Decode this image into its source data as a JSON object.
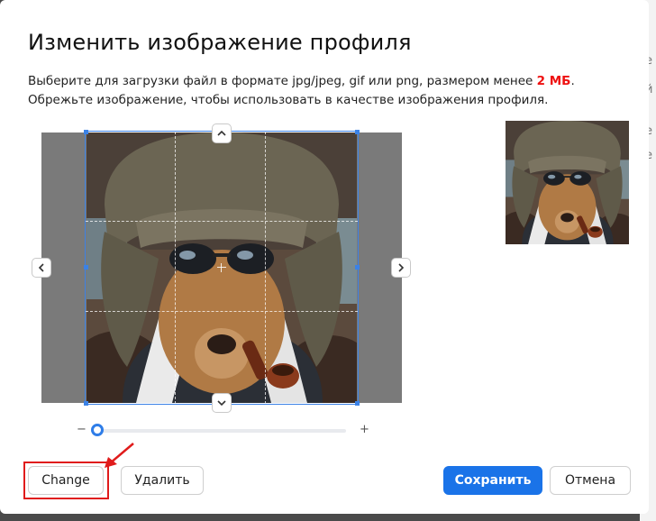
{
  "backdrop": {
    "glyphs": [
      "е",
      "й",
      "е",
      "е"
    ]
  },
  "dialog": {
    "title": "Изменить изображение профиля",
    "description_prefix": "Выберите для загрузки файл в формате jpg/jpeg, gif или png, размером менее ",
    "size_limit": "2 МБ",
    "description_suffix": ".",
    "description_line2": "Обрежьте изображение, чтобы использовать в качестве изображения профиля."
  },
  "cropper": {
    "image": "dog-in-ushanka-hat-with-sunglasses-and-pipe",
    "icons": {
      "up": "chevron-up-icon",
      "down": "chevron-down-icon",
      "left": "chevron-left-icon",
      "right": "chevron-right-icon"
    }
  },
  "zoom": {
    "minus_label": "−",
    "plus_label": "+",
    "level": 0.0
  },
  "buttons": {
    "change": "Change",
    "delete": "Удалить",
    "save": "Сохранить",
    "cancel": "Отмена"
  },
  "colors": {
    "accent": "#1a73e8",
    "size_limit_color": "#e11111",
    "crop_outline": "#3b82e6",
    "annotation": "#e01b1b"
  }
}
